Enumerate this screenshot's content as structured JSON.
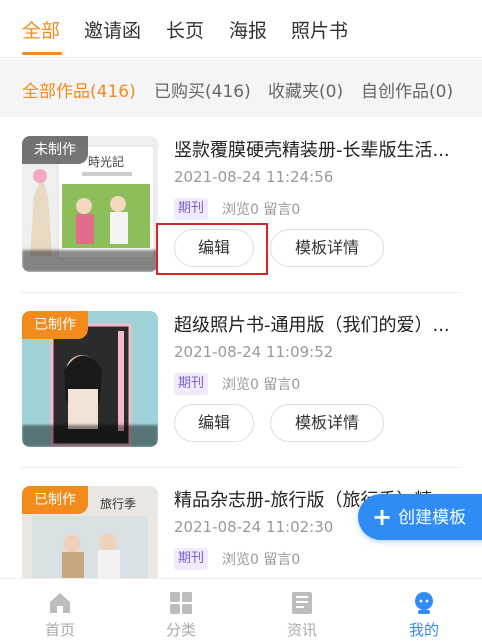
{
  "top_tabs": [
    {
      "label": "全部",
      "active": true
    },
    {
      "label": "邀请函"
    },
    {
      "label": "长页"
    },
    {
      "label": "海报"
    },
    {
      "label": "照片书"
    }
  ],
  "sub_tabs": [
    {
      "label": "全部作品(416)",
      "active": true
    },
    {
      "label": "已购买(416)"
    },
    {
      "label": "收藏夹(0)"
    },
    {
      "label": "自创作品(0)"
    }
  ],
  "items": [
    {
      "status": "未制作",
      "thumb_title": "時光記",
      "title": "竖款覆膜硬壳精装册-长辈版生活...",
      "date": "2021-08-24 11:24:56",
      "tag": "期刊",
      "stats": "浏览0 留言0",
      "edit_label": "编辑",
      "detail_label": "模板详情"
    },
    {
      "status": "已制作",
      "title": "超级照片书-通用版（我们的爱）...",
      "date": "2021-08-24 11:09:52",
      "tag": "期刊",
      "stats": "浏览0 留言0",
      "edit_label": "编辑",
      "detail_label": "模板详情"
    },
    {
      "status": "已制作",
      "thumb_title": "旅行季",
      "title": "精品杂志册-旅行版（旅行季）精...",
      "date": "2021-08-24 11:02:30",
      "tag": "期刊",
      "stats": "浏览0 留言0"
    }
  ],
  "fab": {
    "label": "创建模板",
    "icon": "plus-icon"
  },
  "bottom_nav": [
    {
      "label": "首页",
      "icon": "home-icon"
    },
    {
      "label": "分类",
      "icon": "grid-icon"
    },
    {
      "label": "资讯",
      "icon": "news-icon"
    },
    {
      "label": "我的",
      "icon": "profile-icon",
      "active": true
    }
  ],
  "colors": {
    "accent": "#f28b1b",
    "blue": "#2f8cf5",
    "highlight": "#d8242a",
    "tag": "#7b5fd0"
  }
}
